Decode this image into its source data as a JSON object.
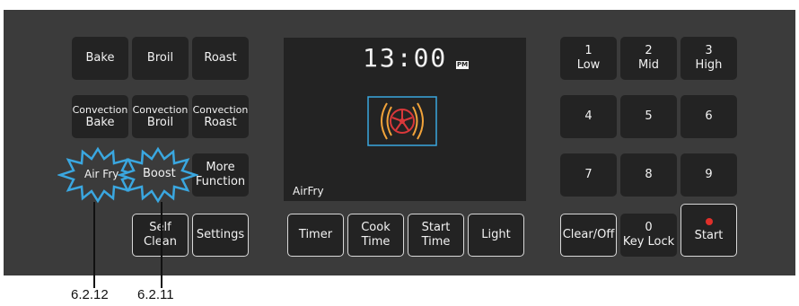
{
  "left_buttons": {
    "bake": "Bake",
    "broil": "Broil",
    "roast": "Roast",
    "convection_bake": [
      "Convection",
      "Bake"
    ],
    "convection_broil": [
      "Convection",
      "Broil"
    ],
    "convection_roast": [
      "Convection",
      "Roast"
    ],
    "air_fry": "Air Fry",
    "boost": "Boost",
    "more_function": [
      "More",
      "Function"
    ],
    "self_clean": [
      "Self",
      "Clean"
    ],
    "settings": "Settings"
  },
  "display": {
    "time": "13:00",
    "ampm": "PM",
    "mode": "AirFry",
    "icon": "air-fry-fan-icon"
  },
  "bottom_buttons": {
    "timer": "Timer",
    "cook_time": [
      "Cook",
      "Time"
    ],
    "start_time": [
      "Start",
      "Time"
    ],
    "light": "Light"
  },
  "keypad": {
    "k1": [
      "1",
      "Low"
    ],
    "k2": [
      "2",
      "Mid"
    ],
    "k3": [
      "3",
      "High"
    ],
    "k4": "4",
    "k5": "5",
    "k6": "6",
    "k7": "7",
    "k8": "8",
    "k9": "9",
    "clear_off": "Clear/Off",
    "k0": [
      "0",
      "Key Lock"
    ],
    "start": "Start"
  },
  "callouts": {
    "air_fry_ref": "6.2.12",
    "boost_ref": "6.2.11"
  },
  "colors": {
    "panel": "#3b3b3b",
    "button": "#232323",
    "text": "#f2f2f2",
    "highlight": "#3aa7e0",
    "fan_red": "#d9383a",
    "fan_orange": "#f2a33a",
    "start_dot": "#e0302a"
  }
}
